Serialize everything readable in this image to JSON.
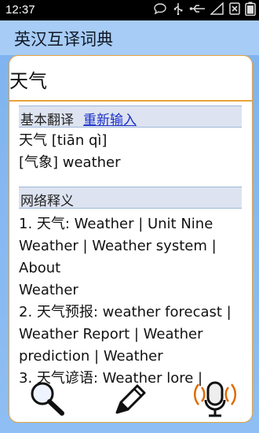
{
  "status": {
    "time": "12:37"
  },
  "app": {
    "title": "英汉互译词典"
  },
  "query": {
    "text": "天气"
  },
  "basic": {
    "header": "基本翻译",
    "reinput": "重新输入",
    "lines": [
      "天气 [tiān qì]",
      "[气象] weather"
    ]
  },
  "web": {
    "header": "网络释义",
    "lines": [
      "1. 天气: Weather | Unit Nine",
      "Weather | Weather system | About",
      "Weather",
      "2. 天气预报: weather forecast |",
      "Weather Report | Weather",
      "prediction | Weather",
      "3. 天气谚语: Weather lore |"
    ]
  },
  "toolbar": {
    "search": "search-icon",
    "edit": "pencil-icon",
    "voice": "microphone-icon"
  },
  "colors": {
    "accent": "#e9a23a",
    "title_bg": "#a7ccf5",
    "link": "#1b2fc9",
    "bg": "#7fb4f0"
  }
}
